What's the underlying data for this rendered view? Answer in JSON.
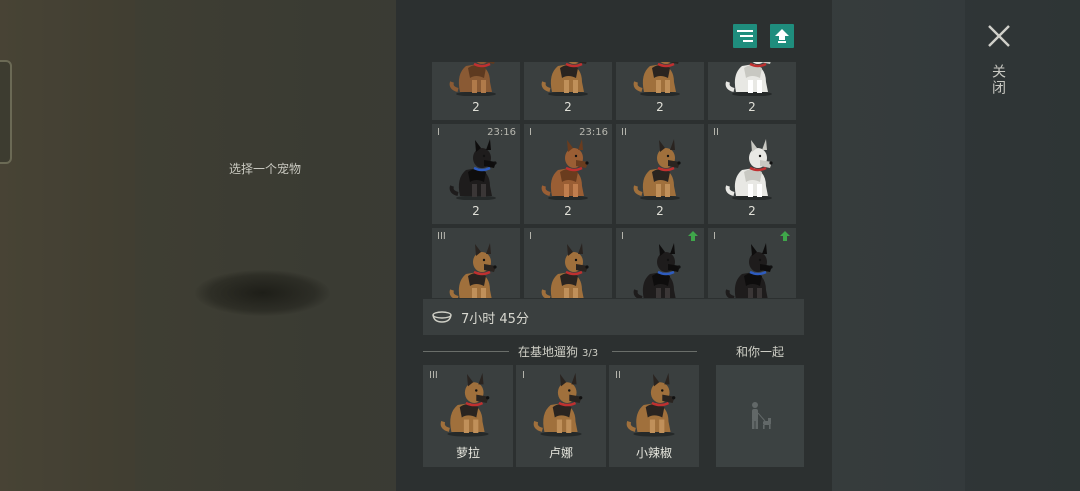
{
  "left_area": {
    "prompt": "选择一个宠物"
  },
  "toolbar": {
    "sort_icon": "sort-lines-icon",
    "upgrade_icon": "upload-arrow-icon",
    "accent": "#1f8d7d"
  },
  "grid": {
    "cells": [
      {
        "tier": "",
        "timer": "",
        "count": "2",
        "upgrade": false,
        "coat": "brown"
      },
      {
        "tier": "",
        "timer": "",
        "count": "2",
        "upgrade": false,
        "coat": "shepherd"
      },
      {
        "tier": "",
        "timer": "",
        "count": "2",
        "upgrade": false,
        "coat": "shepherd"
      },
      {
        "tier": "",
        "timer": "",
        "count": "2",
        "upgrade": false,
        "coat": "white"
      },
      {
        "tier": "I",
        "timer": "23:16",
        "count": "2",
        "upgrade": false,
        "coat": "black-puppy"
      },
      {
        "tier": "I",
        "timer": "23:16",
        "count": "2",
        "upgrade": false,
        "coat": "brown-puppy"
      },
      {
        "tier": "II",
        "timer": "",
        "count": "2",
        "upgrade": false,
        "coat": "shepherd"
      },
      {
        "tier": "II",
        "timer": "",
        "count": "2",
        "upgrade": false,
        "coat": "white"
      },
      {
        "tier": "III",
        "timer": "",
        "count": "",
        "upgrade": false,
        "coat": "shepherd"
      },
      {
        "tier": "I",
        "timer": "",
        "count": "",
        "upgrade": false,
        "coat": "shepherd"
      },
      {
        "tier": "I",
        "timer": "",
        "count": "",
        "upgrade": true,
        "coat": "black-puppy"
      },
      {
        "tier": "I",
        "timer": "",
        "count": "",
        "upgrade": true,
        "coat": "black-puppy"
      }
    ]
  },
  "feeding": {
    "icon": "food-bowl-icon",
    "time": "7小时 45分"
  },
  "base_walking": {
    "title": "在基地遛狗",
    "count": "3/3",
    "dogs": [
      {
        "tier": "III",
        "name": "萝拉"
      },
      {
        "tier": "I",
        "name": "卢娜"
      },
      {
        "tier": "II",
        "name": "小辣椒"
      }
    ]
  },
  "with_you": {
    "title": "和你一起",
    "icon": "person-with-dog-icon"
  },
  "close": {
    "label": "关闭",
    "icon": "close-icon"
  },
  "colors": {
    "upgrade_green": "#3fa64a",
    "panel": "#2c3030",
    "cell": "#3a3f3f"
  }
}
